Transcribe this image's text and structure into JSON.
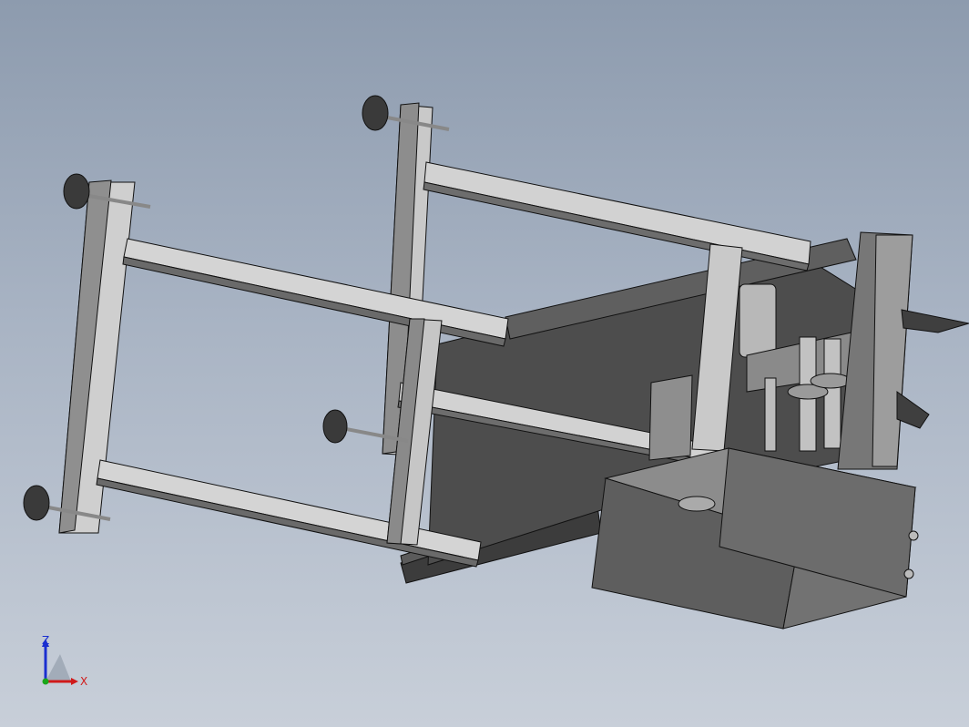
{
  "viewport": {
    "kind": "3d-cad-model-view",
    "background_top": "#8d9bae",
    "background_bottom": "#c8cfd9"
  },
  "colors": {
    "frame_light": "#d4d4d4",
    "frame_mid": "#a9a9a9",
    "frame_dark": "#5a5a5a",
    "panel_dark": "#4a4a4a",
    "box_face": "#6e6e6e",
    "edge": "#111111",
    "foot_pad": "#3a3a3a",
    "axis_z": "#1a2fd0",
    "axis_x": "#d01a1a",
    "axis_y": "#1aa61a"
  },
  "triad": {
    "z_label": "Z",
    "x_label": "X"
  }
}
